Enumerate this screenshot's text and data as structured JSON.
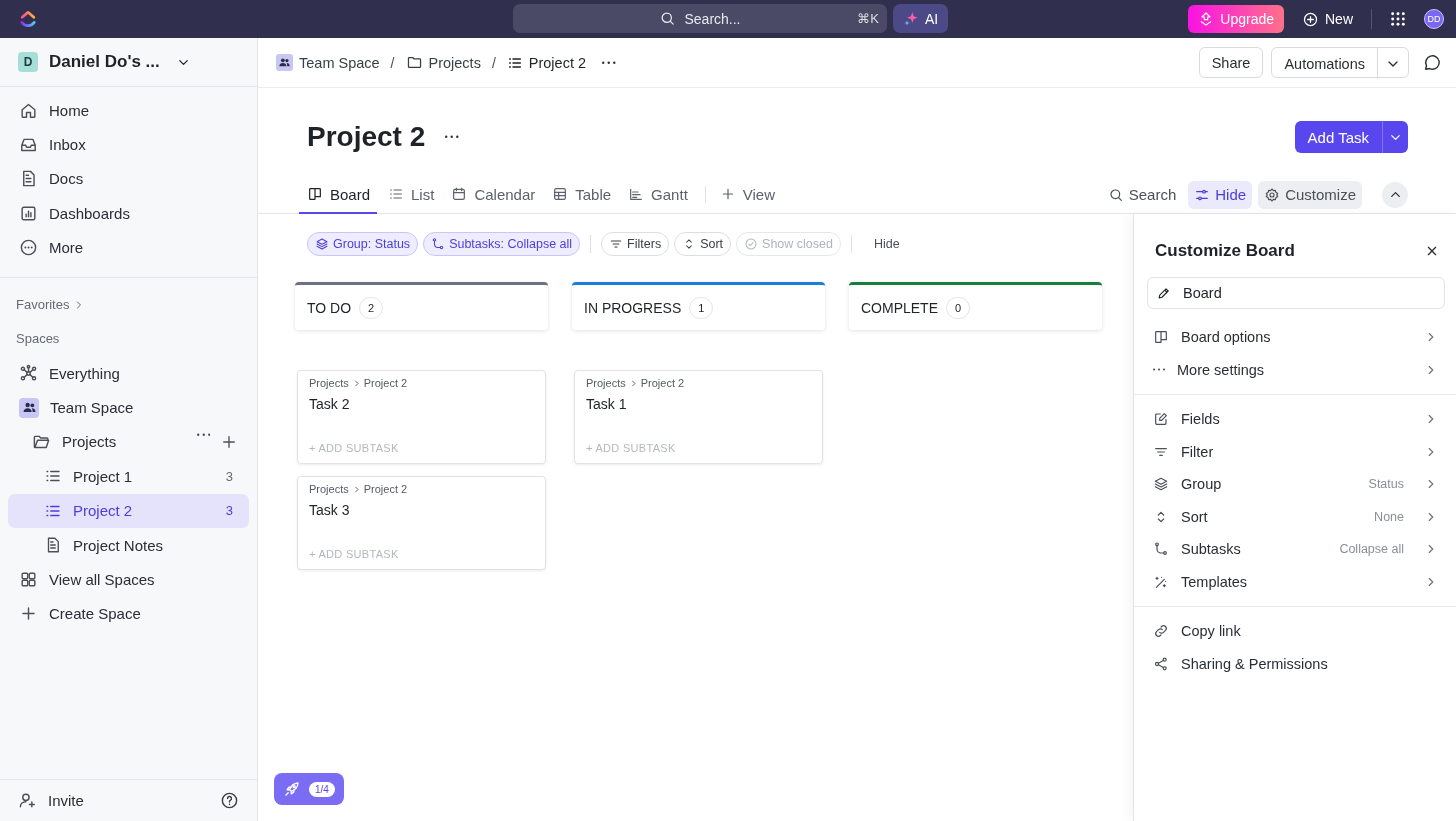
{
  "topbar": {
    "search": {
      "placeholder": "Search...",
      "shortcut": "⌘K"
    },
    "ai": "AI",
    "upgrade": "Upgrade",
    "new": "New",
    "avatar": "DD"
  },
  "sidebar": {
    "workspace": {
      "initial": "D",
      "name": "Daniel Do's ..."
    },
    "nav": [
      {
        "label": "Home"
      },
      {
        "label": "Inbox"
      },
      {
        "label": "Docs"
      },
      {
        "label": "Dashboards"
      },
      {
        "label": "More"
      }
    ],
    "favorites": "Favorites",
    "spaces_heading": "Spaces",
    "tree": [
      {
        "label": "Everything",
        "selected": false
      },
      {
        "label": "Team Space",
        "selected": false,
        "children": [
          {
            "label": "Projects",
            "selected": false,
            "children": [
              {
                "label": "Project 1",
                "count": "3",
                "selected": false
              },
              {
                "label": "Project 2",
                "count": "3",
                "selected": true
              },
              {
                "label": "Project Notes",
                "selected": false
              }
            ]
          }
        ]
      },
      {
        "label": "View all Spaces",
        "selected": false
      },
      {
        "label": "Create Space",
        "selected": false
      }
    ],
    "invite": "Invite"
  },
  "breadcrumb": [
    {
      "label": "Team Space"
    },
    {
      "separator": "/",
      "label": "Projects"
    },
    {
      "separator": "/",
      "label": "Project 2"
    }
  ],
  "header_buttons": {
    "share": "Share",
    "automations": "Automations"
  },
  "title": "Project 2",
  "add_task": "Add Task",
  "views": {
    "tabs": [
      {
        "label": "Board",
        "selected": true
      },
      {
        "label": "List",
        "selected": false
      },
      {
        "label": "Calendar",
        "selected": false
      },
      {
        "label": "Table",
        "selected": false
      },
      {
        "label": "Gantt",
        "selected": false
      }
    ],
    "add_view": "View",
    "tools": [
      {
        "label": "Search",
        "selected": false,
        "expanded": false
      },
      {
        "label": "Hide",
        "selected": true,
        "expanded": false
      },
      {
        "label": "Customize",
        "selected": false,
        "expanded": true
      }
    ]
  },
  "filters": {
    "chips": [
      {
        "label": "Group: Status",
        "applied": true,
        "disabled": false
      },
      {
        "label": "Subtasks: Collapse all",
        "applied": true,
        "disabled": false
      },
      {
        "label": "Filters",
        "applied": false,
        "disabled": false
      },
      {
        "label": "Sort",
        "applied": false,
        "disabled": false
      },
      {
        "label": "Show closed",
        "applied": false,
        "disabled": true
      }
    ],
    "hide": "Hide"
  },
  "columns": [
    {
      "name": "TO DO",
      "count": "2",
      "color": "#6b7280",
      "tasks": [
        {
          "path": [
            "Projects",
            "Project 2"
          ],
          "title": "Task 2",
          "add_subtask": "+ ADD SUBTASK"
        },
        {
          "path": [
            "Projects",
            "Project 2"
          ],
          "title": "Task 3",
          "add_subtask": "+ ADD SUBTASK"
        }
      ]
    },
    {
      "name": "IN PROGRESS",
      "count": "1",
      "color": "#1a7fd9",
      "tasks": [
        {
          "path": [
            "Projects",
            "Project 2"
          ],
          "title": "Task 1",
          "add_subtask": "+ ADD SUBTASK"
        }
      ]
    },
    {
      "name": "COMPLETE",
      "count": "0",
      "color": "#13803c"
    }
  ],
  "panel": {
    "title": "Customize Board",
    "name_value": "Board",
    "sections": [
      [
        {
          "label": "Board options",
          "submenu": true
        },
        {
          "label": "More settings",
          "submenu": true
        }
      ],
      [
        {
          "label": "Fields",
          "submenu": true
        },
        {
          "label": "Filter",
          "submenu": true
        },
        {
          "label": "Group",
          "value": "Status",
          "submenu": true
        },
        {
          "label": "Sort",
          "value": "None",
          "submenu": true
        },
        {
          "label": "Subtasks",
          "value": "Collapse all",
          "submenu": true
        },
        {
          "label": "Templates",
          "submenu": true
        }
      ],
      [
        {
          "label": "Copy link",
          "submenu": false
        },
        {
          "label": "Sharing & Permissions",
          "submenu": false
        }
      ]
    ]
  },
  "onboarding": {
    "progress": "1/4"
  }
}
